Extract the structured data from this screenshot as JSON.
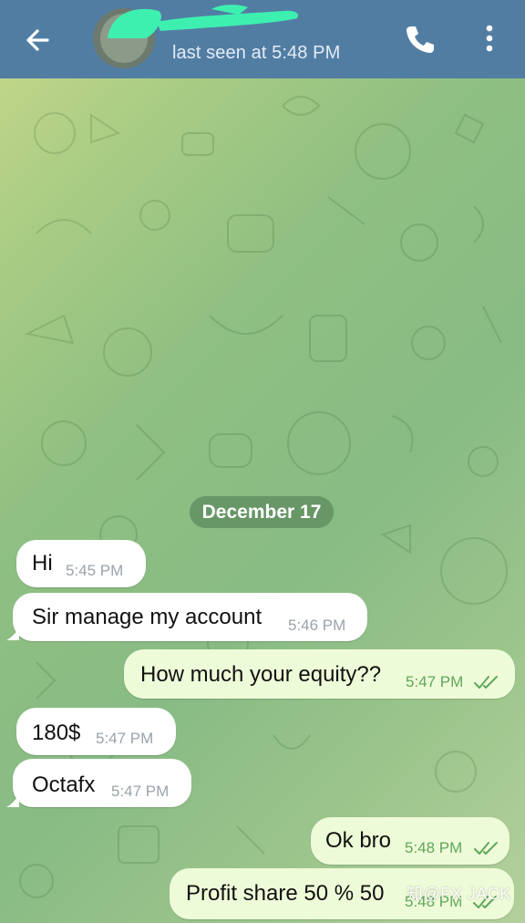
{
  "header": {
    "status": "last seen at 5:48 PM",
    "bg_color": "#527da3",
    "back_icon": "arrow-left-icon",
    "call_icon": "phone-icon",
    "more_icon": "more-vertical-icon"
  },
  "chat": {
    "date": "December 17",
    "messages": [
      {
        "dir": "in",
        "text": "Hi",
        "time": "5:45 PM"
      },
      {
        "dir": "in",
        "text": "Sir manage my account",
        "time": "5:46 PM"
      },
      {
        "dir": "out",
        "text": "How much your equity??",
        "time": "5:47 PM"
      },
      {
        "dir": "in",
        "text": "180$",
        "time": "5:47 PM"
      },
      {
        "dir": "in",
        "text": "Octafx",
        "time": "5:47 PM"
      },
      {
        "dir": "out",
        "text": "Ok bro",
        "time": "5:48 PM"
      },
      {
        "dir": "out",
        "text": "Profit share 50 % 50",
        "time": "5:48 PM"
      }
    ]
  },
  "watermark": "知@FX JACK",
  "colors": {
    "incoming_bubble": "#ffffff",
    "outgoing_bubble": "#eefbd8",
    "read_tick": "#5fa85a"
  }
}
